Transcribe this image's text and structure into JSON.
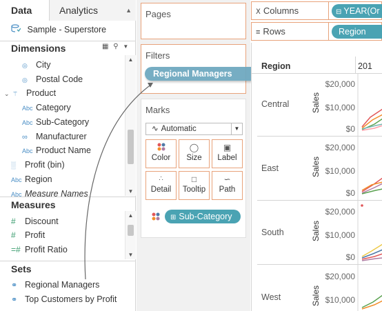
{
  "tabs": {
    "data": "Data",
    "analytics": "Analytics"
  },
  "datasource": "Sample - Superstore",
  "dimensions": {
    "title": "Dimensions",
    "items": [
      {
        "label": "City",
        "icon": "globe-icon"
      },
      {
        "label": "Postal Code",
        "icon": "globe-icon"
      },
      {
        "label": "Product",
        "icon": "hierarchy-icon"
      },
      {
        "label": "Category",
        "icon": "abc-icon"
      },
      {
        "label": "Sub-Category",
        "icon": "abc-icon"
      },
      {
        "label": "Manufacturer",
        "icon": "paperclip-icon"
      },
      {
        "label": "Product Name",
        "icon": "abc-icon"
      },
      {
        "label": "Profit (bin)",
        "icon": "bin-icon"
      },
      {
        "label": "Region",
        "icon": "abc-icon"
      },
      {
        "label": "Measure Names",
        "icon": "abc-icon"
      }
    ]
  },
  "measures": {
    "title": "Measures",
    "items": [
      {
        "label": "Discount"
      },
      {
        "label": "Profit"
      },
      {
        "label": "Profit Ratio"
      }
    ]
  },
  "sets": {
    "title": "Sets",
    "items": [
      {
        "label": "Regional Managers"
      },
      {
        "label": "Top Customers by Profit"
      }
    ]
  },
  "cards": {
    "pages": "Pages",
    "filters": "Filters",
    "filter_pill": "Regional Managers",
    "marks": "Marks",
    "mark_type": "Automatic",
    "buttons": [
      "Color",
      "Size",
      "Label",
      "Detail",
      "Tooltip",
      "Path"
    ],
    "marks_pill": "Sub-Category"
  },
  "shelves": {
    "columns_label": "Columns",
    "columns_pill": "YEAR(Or",
    "rows_label": "Rows",
    "rows_pill": "Region"
  },
  "view": {
    "region_header": "Region",
    "year_header": "201",
    "regions": [
      "Central",
      "East",
      "South",
      "West"
    ],
    "ticks": [
      "$20,000",
      "$10,000",
      "$0"
    ],
    "axis_label": "Sales"
  },
  "colors": {
    "accent_border": "#e8a27a",
    "pill_blue": "#4aa3b3",
    "tableau_blue": "#4a8ec5"
  }
}
